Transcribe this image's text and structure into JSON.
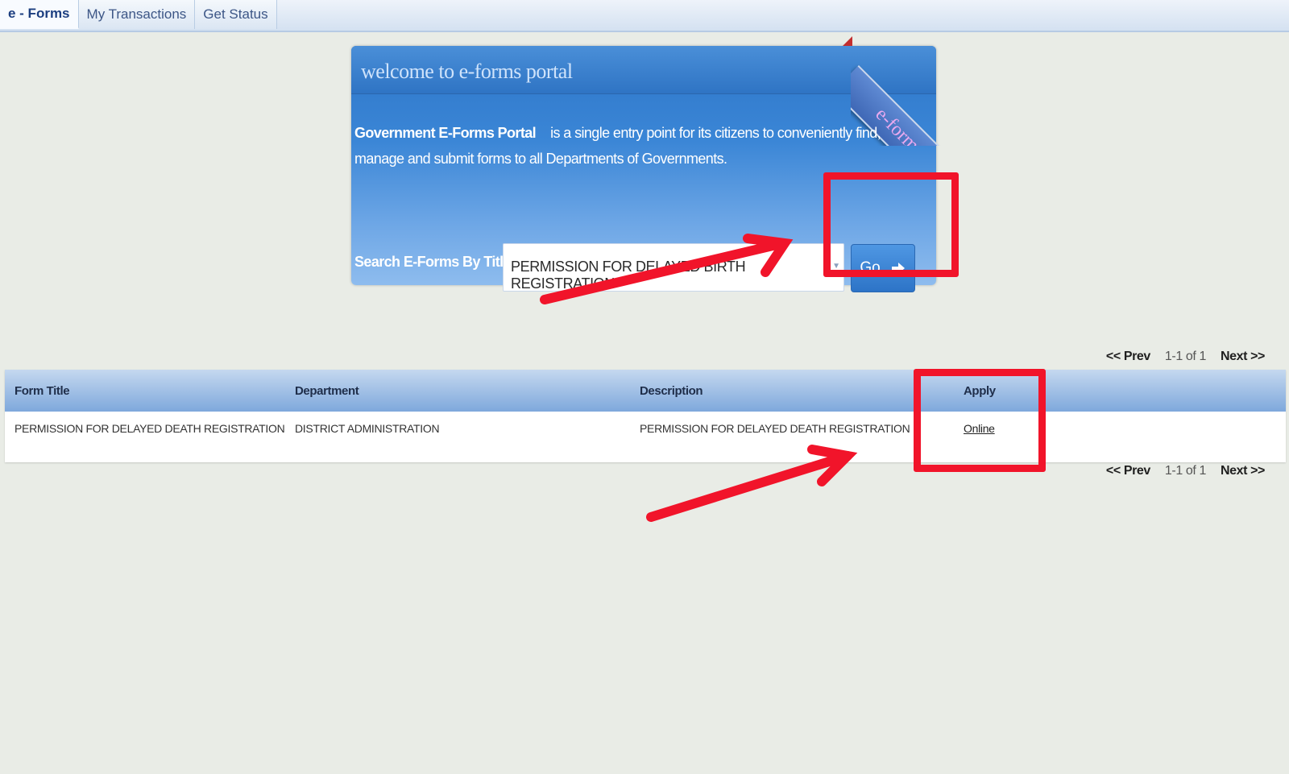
{
  "tabs": [
    {
      "label": "e - Forms",
      "active": true
    },
    {
      "label": "My Transactions",
      "active": false
    },
    {
      "label": "Get Status",
      "active": false
    }
  ],
  "panel": {
    "title": "welcome to e-forms portal",
    "ribbon": "e-forms",
    "intro_bold": "Government E-Forms Portal",
    "intro_text": "is a single entry point for its citizens to conveniently find, manage and submit forms to all Departments of Governments.",
    "search_label": "Search E-Forms By Title :",
    "search_value": "PERMISSION FOR DELAYED BIRTH REGISTRATION",
    "go_label": "Go"
  },
  "pager": {
    "prev": "<< Prev",
    "count": "1-1 of 1",
    "next": "Next >>"
  },
  "table": {
    "headers": [
      "Form Title",
      "Department",
      "Description",
      "Apply"
    ],
    "rows": [
      [
        "PERMISSION FOR DELAYED DEATH REGISTRATION",
        "DISTRICT ADMINISTRATION",
        "PERMISSION FOR DELAYED DEATH REGISTRATION",
        "Online"
      ]
    ]
  },
  "colors": {
    "annotation": "#f1142a",
    "panel_blue": "#3b86d6",
    "header_blue": "#7ea8dc"
  }
}
